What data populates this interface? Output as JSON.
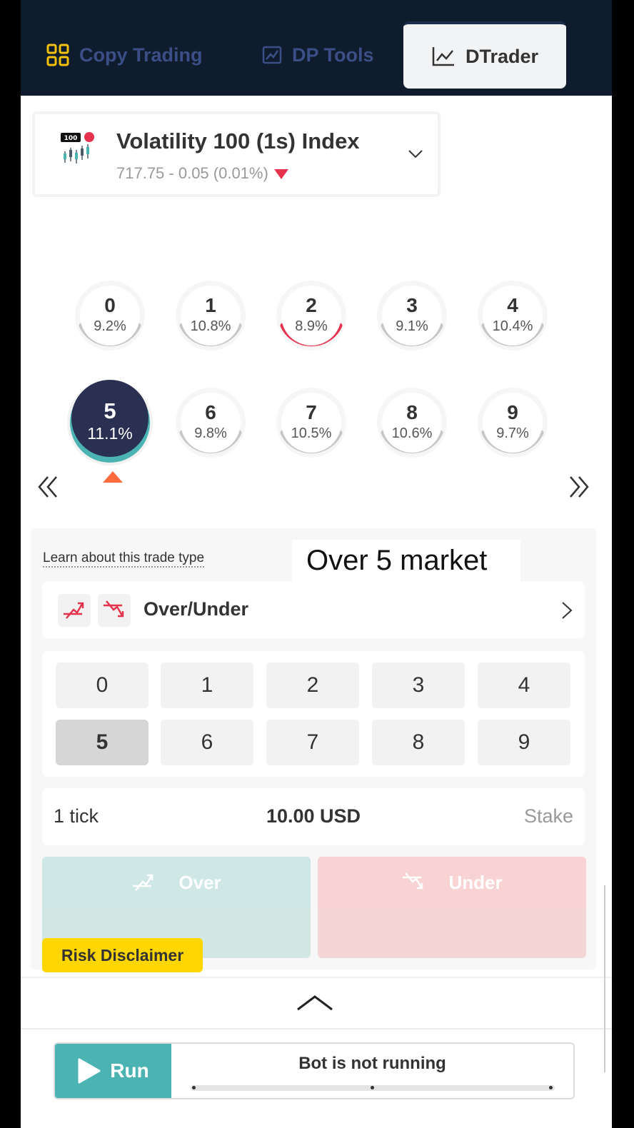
{
  "nav": {
    "tabs": [
      {
        "label": "Copy Trading",
        "icon": "grid-icon"
      },
      {
        "label": "DP Tools",
        "icon": "chart-frame-icon"
      },
      {
        "label": "DTrader",
        "icon": "line-chart-icon",
        "active": true
      }
    ]
  },
  "symbol": {
    "name": "Volatility 100 (1s) Index",
    "price": "717.75 - 0.05 (0.01%)",
    "icon_badge": "100",
    "direction": "down"
  },
  "digits": [
    {
      "digit": "0",
      "pct": "9.2%"
    },
    {
      "digit": "1",
      "pct": "10.8%"
    },
    {
      "digit": "2",
      "pct": "8.9%",
      "highlight": "lowest"
    },
    {
      "digit": "3",
      "pct": "9.1%"
    },
    {
      "digit": "4",
      "pct": "10.4%"
    },
    {
      "digit": "5",
      "pct": "11.1%",
      "highlight": "highest",
      "selected": true
    },
    {
      "digit": "6",
      "pct": "9.8%"
    },
    {
      "digit": "7",
      "pct": "10.5%"
    },
    {
      "digit": "8",
      "pct": "10.6%"
    },
    {
      "digit": "9",
      "pct": "9.7%"
    }
  ],
  "trade": {
    "learn_link": "Learn about this trade type",
    "overlay_caption": "Over 5 market",
    "trade_type": "Over/Under",
    "prediction_digits": [
      "0",
      "1",
      "2",
      "3",
      "4",
      "5",
      "6",
      "7",
      "8",
      "9"
    ],
    "selected_digit": "5",
    "duration": "1 tick",
    "amount": "10.00 USD",
    "amount_label": "Stake",
    "over_label": "Over",
    "under_label": "Under"
  },
  "risk_label": "Risk Disclaimer",
  "bot": {
    "run_label": "Run",
    "status": "Bot is not running"
  },
  "colors": {
    "nav_bg": "#0e1c2e",
    "accent_teal": "#4bb4b3",
    "accent_red": "#e6334d",
    "selected_digit_bg": "#2a3052",
    "risk_yellow": "#ffd600"
  }
}
